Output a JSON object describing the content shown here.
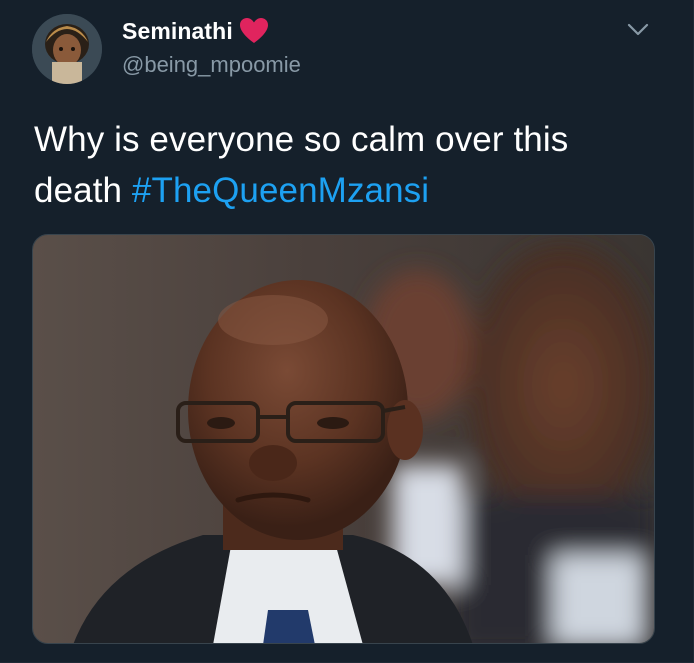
{
  "tweet": {
    "display_name": "Seminathi",
    "display_name_emoji": "heart-icon",
    "handle": "@being_mpoomie",
    "text_plain": "Why is everyone so calm over this death ",
    "hashtag": "#TheQueenMzansi",
    "media_description": "photo"
  },
  "icons": {
    "heart": "heart-icon",
    "more": "chevron-down-icon"
  },
  "colors": {
    "background": "#15202b",
    "text": "#ffffff",
    "secondary_text": "#8899a6",
    "link": "#1da1f2",
    "heart": "#e0245e"
  }
}
